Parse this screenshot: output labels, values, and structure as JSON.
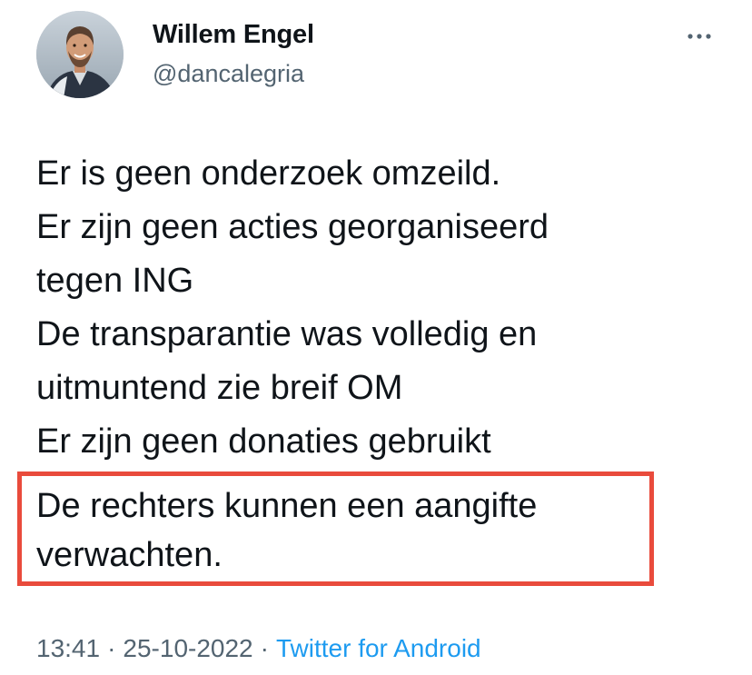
{
  "tweet": {
    "author": {
      "display_name": "Willem Engel",
      "handle": "@dancalegria"
    },
    "lines": [
      "Er is geen onderzoek omzeild.",
      "Er zijn geen acties georganiseerd",
      "tegen ING",
      "De transparantie was volledig en",
      "uitmuntend zie breif OM",
      "Er zijn geen donaties gebruikt"
    ],
    "highlighted_lines": [
      "De rechters kunnen een aangifte",
      "verwachten."
    ],
    "time": "13:41",
    "date": "25-10-2022",
    "separator": "·",
    "source": "Twitter for Android"
  },
  "icons": {
    "more": "more-horizontal-icon",
    "avatar": "profile-photo"
  },
  "colors": {
    "text": "#0f1419",
    "secondary": "#536471",
    "link": "#1d9bf0",
    "highlight_border": "#e94b3c"
  }
}
